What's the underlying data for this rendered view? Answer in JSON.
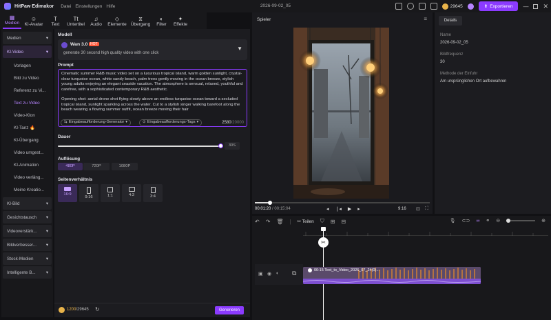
{
  "titlebar": {
    "app_name": "HitPaw Edimakor",
    "menu": [
      "Datei",
      "Einstellungen",
      "Hilfe"
    ],
    "project_title": "2026-09-02_05",
    "credits": "29645",
    "export_label": "Exportieren"
  },
  "toolbar": {
    "tabs": [
      {
        "label": "Medien",
        "icon": "media-icon"
      },
      {
        "label": "KI-Avatar",
        "icon": "avatar-icon"
      },
      {
        "label": "Text",
        "icon": "text-icon"
      },
      {
        "label": "Untertitel",
        "icon": "subtitle-icon"
      },
      {
        "label": "Audio",
        "icon": "audio-icon"
      },
      {
        "label": "Elemente",
        "icon": "elements-icon"
      },
      {
        "label": "Übergang",
        "icon": "transition-icon"
      },
      {
        "label": "Filter",
        "icon": "filter-icon"
      },
      {
        "label": "Effekte",
        "icon": "effects-icon"
      }
    ]
  },
  "sidebar": {
    "items": [
      {
        "label": "Medien",
        "type": "cat"
      },
      {
        "label": "KI-Video",
        "type": "cat-sel"
      },
      {
        "label": "Vorlagen",
        "type": "sub"
      },
      {
        "label": "Bild zu Video",
        "type": "sub"
      },
      {
        "label": "Referenz zu Vi...",
        "type": "sub"
      },
      {
        "label": "Text zu Video",
        "type": "sub-sel"
      },
      {
        "label": "Video-Klon",
        "type": "sub"
      },
      {
        "label": "KI-Tanz 🔥",
        "type": "sub"
      },
      {
        "label": "KI-Übergang",
        "type": "sub"
      },
      {
        "label": "Video umgest...",
        "type": "sub"
      },
      {
        "label": "KI-Animation",
        "type": "sub"
      },
      {
        "label": "Video verläng...",
        "type": "sub"
      },
      {
        "label": "Meine Kreatio...",
        "type": "sub"
      },
      {
        "label": "KI-Bild",
        "type": "cat"
      },
      {
        "label": "Gesichtstausch",
        "type": "cat"
      },
      {
        "label": "Videoverstärk...",
        "type": "cat"
      },
      {
        "label": "Bildverbesser...",
        "type": "cat"
      },
      {
        "label": "Stock-Medien",
        "type": "cat"
      },
      {
        "label": "Intelligente B...",
        "type": "cat"
      }
    ]
  },
  "panel": {
    "model_label": "Modell",
    "model_name": "Wan 3.0",
    "model_badge": "HOT",
    "model_desc": "generate 30 second high quality video with one click",
    "prompt_label": "Prompt",
    "prompt_text": "Cinematic summer R&B music video set on a luxurious tropical island, warm golden sunlight, crystal-clear turquoise ocean, white sandy beach, palm trees gently moving in the ocean breeze, stylish young adults enjoying an elegant seaside vacation. The atmosphere is sensual, relaxed, youthful and carefree, with a sophisticated contemporary R&B aesthetic.",
    "prompt_text2": "Opening shot: aerial drone shot flying slowly above an endless turquoise ocean toward a secluded tropical island, sunlight sparkling across the water. Cut to a stylish singer walking barefoot along the beach wearing a flowing summer outfit, ocean breeze moving their hair",
    "chip1": "Eingabeaufforderung-Generator",
    "chip2": "Eingabeaufforderungs-Tags",
    "char_count": "2580",
    "char_max": "/20000",
    "duration_label": "Dauer",
    "duration_value": "30S",
    "duration_fraction": 1.0,
    "resolution_label": "Auflösung",
    "resolutions": [
      "480P",
      "720P",
      "1080P"
    ],
    "ratio_label": "Seitenverhältnis",
    "ratios": [
      "16:9",
      "9:16",
      "1:1",
      "4:3",
      "3:4"
    ],
    "credits_used": "1200",
    "credits_total": "/29645",
    "generate_label": "Generieren"
  },
  "player": {
    "title": "Spieler",
    "time_current": "00:01:20",
    "time_total": "/ 00:15:04",
    "aspect": "9:16",
    "progress_fraction": 0.088
  },
  "details": {
    "tab": "Details",
    "name_label": "Name",
    "name_value": "2026-09-02_05",
    "fps_label": "Bildfrequenz",
    "fps_value": "30",
    "import_label": "Methode der Einfuhr",
    "import_value": "Am ursprünglichen Ort aufbewahren"
  },
  "timeline": {
    "split_label": "Teilen",
    "clip_name": "00:15 Text_to_Video_2026_07_24(0)..."
  }
}
